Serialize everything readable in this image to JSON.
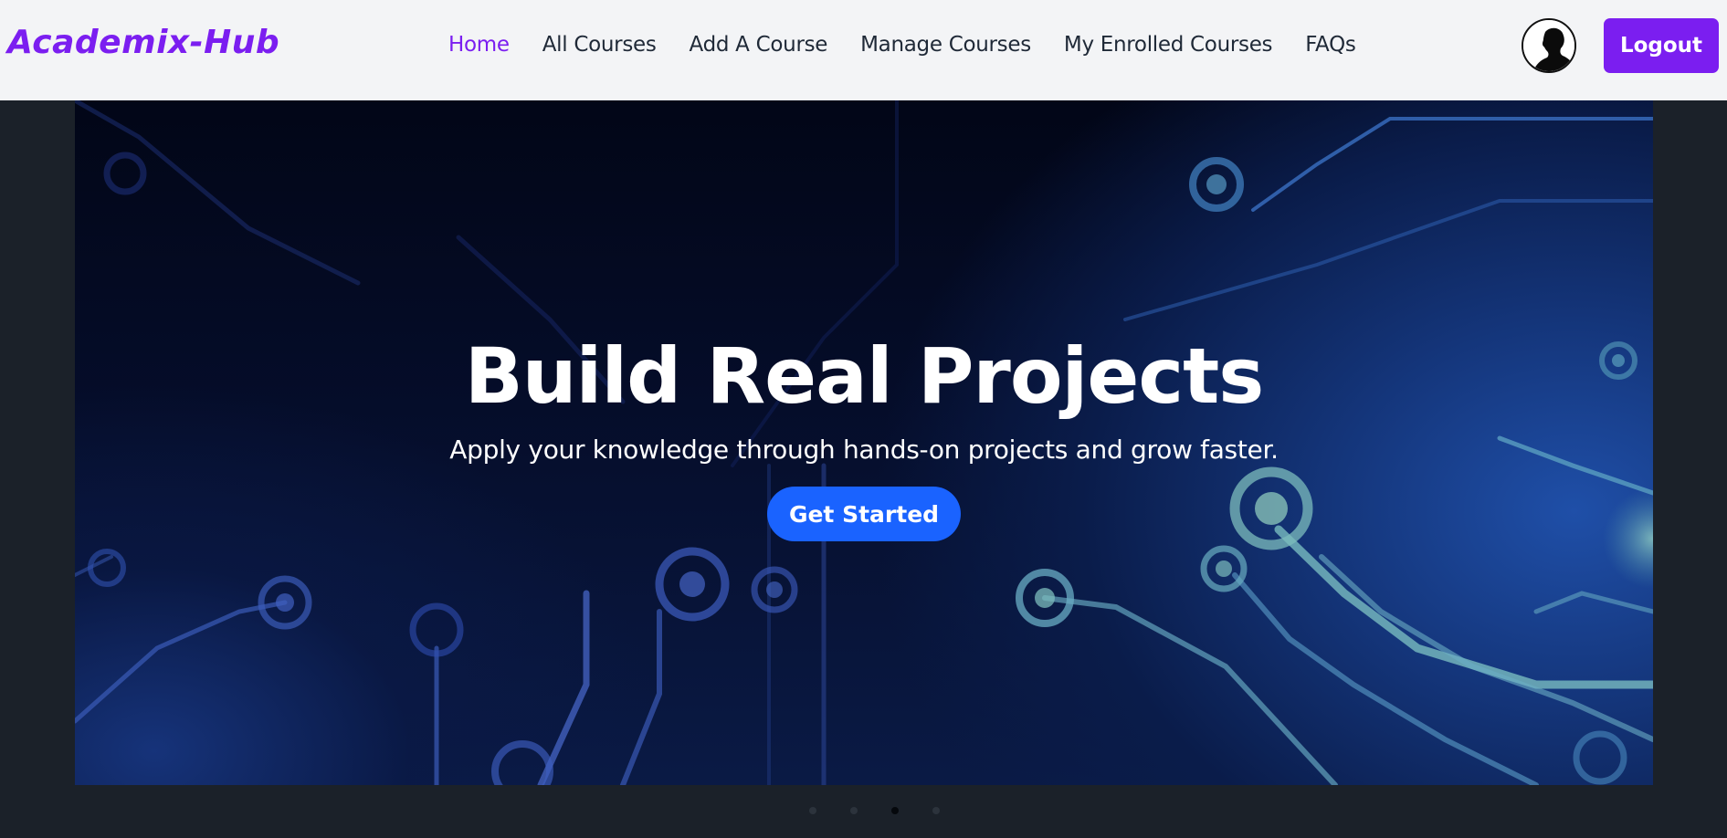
{
  "brand": {
    "name": "Academix-Hub"
  },
  "nav": {
    "items": [
      {
        "label": "Home",
        "active": true
      },
      {
        "label": "All Courses",
        "active": false
      },
      {
        "label": "Add A Course",
        "active": false
      },
      {
        "label": "Manage Courses",
        "active": false
      },
      {
        "label": "My Enrolled Courses",
        "active": false
      },
      {
        "label": "FAQs",
        "active": false
      }
    ],
    "avatar_icon": "user-silhouette-icon",
    "logout_label": "Logout"
  },
  "hero": {
    "title": "Build Real Projects",
    "subtitle": "Apply your knowledge through hands-on projects and grow faster.",
    "cta_label": "Get Started",
    "background": "circuit-board-image"
  },
  "carousel": {
    "slide_count": 4,
    "active_index": 2
  },
  "colors": {
    "brand_purple": "#7b1ef0",
    "cta_blue": "#1a63ff",
    "navbar_bg": "#f3f4f6",
    "page_bg": "#1b2129"
  }
}
